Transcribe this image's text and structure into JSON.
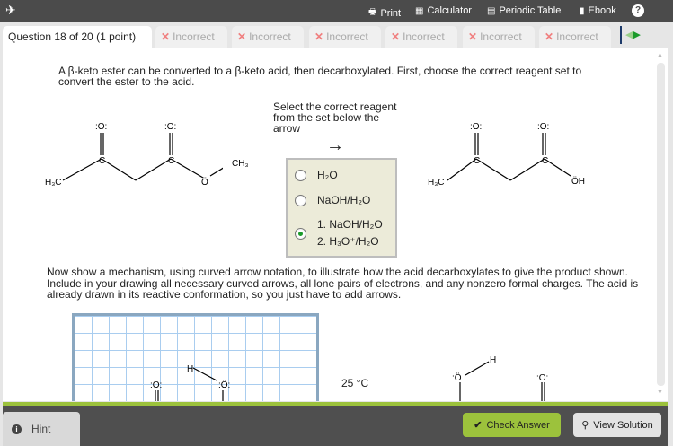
{
  "topbar": {
    "print": "Print",
    "calculator": "Calculator",
    "periodic_table": "Periodic Table",
    "ebook": "Ebook",
    "help": "?"
  },
  "tabs": {
    "current": "Question 18 of 20 (1 point)",
    "incorrect": [
      "Incorrect",
      "Incorrect",
      "Incorrect",
      "Incorrect",
      "Incorrect",
      "Incorrect"
    ]
  },
  "question": {
    "intro": "A β-keto ester can be converted to a β-keto acid, then decarboxylated. First, choose the correct reagent set to convert the ester to the acid.",
    "select_prompt": "Select the correct reagent from the set below the arrow",
    "arrow": "→",
    "options": [
      {
        "line1": "H₂O",
        "selected": false
      },
      {
        "line1": "NaOH/H₂O",
        "selected": false
      },
      {
        "line1": "1. NaOH/H₂O",
        "line2": "2. H₃O⁺/H₂O",
        "selected": true
      }
    ],
    "mechanism_prompt": "Now show a mechanism, using curved arrow notation, to illustrate how the acid decarboxylates to give the product shown. Include in your drawing all necessary curved arrows, all lone pairs of electrons, and any nonzero formal charges. The acid is already drawn in its reactive conformation, so you just have to add arrows.",
    "temperature": "25 °C"
  },
  "atoms": {
    "o": ":O:",
    "c": "C",
    "h3c": "H₃C",
    "ch3": "CH₃",
    "o_ester": "Ö",
    "oh": "ÖH",
    "h": "H",
    "o_lp": ":Ö:",
    "o_left": ":Ö"
  },
  "footer": {
    "hint": "Hint",
    "check": "Check Answer",
    "view": "View Solution"
  }
}
